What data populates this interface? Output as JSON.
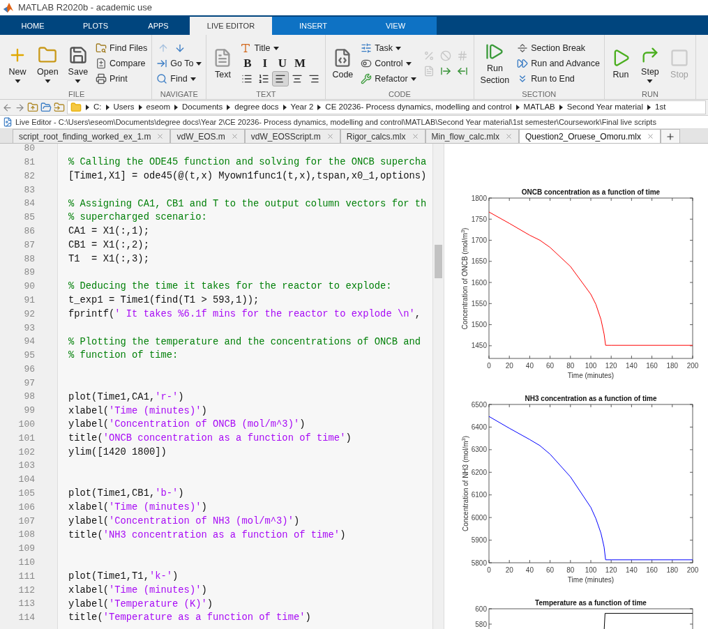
{
  "window": {
    "title": "MATLAB R2020b - academic use"
  },
  "ribbon": {
    "tabs": [
      {
        "label": "HOME",
        "selected": false,
        "kind": "main"
      },
      {
        "label": "PLOTS",
        "selected": false,
        "kind": "main"
      },
      {
        "label": "APPS",
        "selected": false,
        "kind": "main"
      },
      {
        "label": "LIVE EDITOR",
        "selected": true,
        "kind": "main"
      },
      {
        "label": "INSERT",
        "selected": false,
        "kind": "contextual"
      },
      {
        "label": "VIEW",
        "selected": false,
        "kind": "contextual"
      }
    ],
    "groups": [
      {
        "label": "FILE",
        "columns": [
          [
            [
              {
                "kind": "large",
                "label": "New",
                "caret": true
              }
            ]
          ],
          [
            [
              {
                "kind": "large",
                "label": "Open",
                "caret": true
              }
            ]
          ],
          [
            [
              {
                "kind": "large",
                "label": "Save",
                "caret": true
              }
            ]
          ],
          [
            [
              {
                "kind": "small",
                "label": "Find Files"
              }
            ],
            [
              {
                "kind": "small",
                "label": "Compare"
              }
            ],
            [
              {
                "kind": "small",
                "label": "Print"
              }
            ]
          ]
        ]
      },
      {
        "label": "NAVIGATE",
        "columns": [
          [
            [
              {
                "kind": "icon",
                "disabled": true
              },
              {
                "kind": "icon",
                "disabled": false
              }
            ],
            [
              {
                "kind": "small",
                "label": "Go To",
                "caret": true
              }
            ],
            [
              {
                "kind": "small",
                "label": "Find",
                "caret": true
              }
            ]
          ]
        ]
      },
      {
        "label": "TEXT",
        "columns": [
          [
            [
              {
                "kind": "large",
                "label": "Text"
              }
            ]
          ],
          [
            [
              {
                "kind": "small",
                "label": "Title",
                "caret": true
              }
            ],
            [
              {
                "kind": "format",
                "label": "B"
              },
              {
                "kind": "format",
                "label": "I"
              },
              {
                "kind": "format",
                "label": "U"
              },
              {
                "kind": "format",
                "label": "M"
              }
            ],
            [
              {
                "kind": "icon",
                "selected": false
              },
              {
                "kind": "icon",
                "selected": false
              },
              {
                "kind": "icon",
                "selected": true
              },
              {
                "kind": "icon",
                "selected": false
              },
              {
                "kind": "icon",
                "selected": false
              }
            ]
          ]
        ]
      },
      {
        "label": "CODE",
        "columns": [
          [
            [
              {
                "kind": "large",
                "label": "Code"
              }
            ]
          ],
          [
            [
              {
                "kind": "small",
                "label": "Task",
                "caret": true
              }
            ],
            [
              {
                "kind": "small",
                "label": "Control",
                "caret": true
              }
            ],
            [
              {
                "kind": "small",
                "label": "Refactor",
                "caret": true
              }
            ]
          ],
          [
            [
              {
                "kind": "icon",
                "disabled": true
              },
              {
                "kind": "icon",
                "disabled": true
              },
              {
                "kind": "icon",
                "disabled": true
              }
            ],
            [
              {
                "kind": "icon",
                "disabled": true
              },
              {
                "kind": "icon",
                "disabled": false
              },
              {
                "kind": "icon",
                "disabled": false
              }
            ]
          ]
        ]
      },
      {
        "label": "SECTION",
        "columns": [
          [
            [
              {
                "kind": "large",
                "label": "Run Section"
              }
            ]
          ],
          [
            [
              {
                "kind": "small",
                "label": "Section Break"
              }
            ],
            [
              {
                "kind": "small",
                "label": "Run and Advance"
              }
            ],
            [
              {
                "kind": "small",
                "label": "Run to End"
              }
            ]
          ]
        ]
      },
      {
        "label": "RUN",
        "columns": [
          [
            [
              {
                "kind": "large",
                "label": "Run"
              }
            ]
          ],
          [
            [
              {
                "kind": "large",
                "label": "Step",
                "caret": true
              }
            ]
          ],
          [
            [
              {
                "kind": "large",
                "label": "Stop",
                "disabled": true
              }
            ]
          ]
        ]
      }
    ]
  },
  "address_bar": {
    "crumbs": [
      "C:",
      "Users",
      "eseom",
      "Documents",
      "degree docs",
      "Year 2",
      "CE 20236- Process dynamics, modelling and control",
      "MATLAB",
      "Second Year material",
      "1st"
    ]
  },
  "editor_path": "Live Editor - C:\\Users\\eseom\\Documents\\degree docs\\Year 2\\CE 20236- Process dynamics, modelling and control\\MATLAB\\Second Year material\\1st semester\\Coursework\\Final live scripts",
  "file_tabs": [
    {
      "label": "script_root_finding_worked_ex_1.m",
      "selected": false
    },
    {
      "label": "vdW_EOS.m",
      "selected": false
    },
    {
      "label": "vdW_EOSScript.m",
      "selected": false
    },
    {
      "label": "Rigor_calcs.mlx",
      "selected": false
    },
    {
      "label": "Min_flow_calc.mlx",
      "selected": false
    },
    {
      "label": "Question2_Oruese_Omoru.mlx",
      "selected": true
    }
  ],
  "code_lines": [
    {
      "number": "80"
    },
    {
      "number": "81",
      "segments": [
        {
          "kind": "comment",
          "text": "% Calling the ODE45 function and solving for the ONCB supercha"
        }
      ]
    },
    {
      "number": "82",
      "segments": [
        {
          "kind": "code",
          "text": "[Time1,X1] = ode45(@(t,x) Myown1func1(t,x),tspan,x0_1,options)"
        }
      ]
    },
    {
      "number": "83"
    },
    {
      "number": "84",
      "segments": [
        {
          "kind": "comment",
          "text": "% Assigning CA1, CB1 and T to the output column vectors for th"
        }
      ]
    },
    {
      "number": "85",
      "segments": [
        {
          "kind": "comment",
          "text": "% supercharged scenario:"
        }
      ]
    },
    {
      "number": "86",
      "segments": [
        {
          "kind": "code",
          "text": "CA1 = X1(:,1);"
        }
      ]
    },
    {
      "number": "87",
      "segments": [
        {
          "kind": "code",
          "text": "CB1 = X1(:,2);"
        }
      ]
    },
    {
      "number": "88",
      "segments": [
        {
          "kind": "code",
          "text": "T1  = X1(:,3);"
        }
      ]
    },
    {
      "number": "89"
    },
    {
      "number": "90",
      "segments": [
        {
          "kind": "comment",
          "text": "% Deducing the time it takes for the reactor to explode:"
        }
      ]
    },
    {
      "number": "91",
      "segments": [
        {
          "kind": "code",
          "text": "t_exp1 = Time1(find(T1 > 593,1));"
        }
      ]
    },
    {
      "number": "92",
      "segments": [
        {
          "kind": "code",
          "text": "fprintf("
        },
        {
          "kind": "string",
          "text": "' It takes %6.1f mins for the reactor to explode \\n'"
        },
        {
          "kind": "code",
          "text": ","
        }
      ]
    },
    {
      "number": "93"
    },
    {
      "number": "94",
      "segments": [
        {
          "kind": "comment",
          "text": "% Plotting the temperature and the concentrations of ONCB and"
        }
      ]
    },
    {
      "number": "95",
      "segments": [
        {
          "kind": "comment",
          "text": "% function of time:"
        }
      ]
    },
    {
      "number": "96"
    },
    {
      "number": "97"
    },
    {
      "number": "98",
      "segments": [
        {
          "kind": "code",
          "text": "plot(Time1,CA1,"
        },
        {
          "kind": "string",
          "text": "'r-'"
        },
        {
          "kind": "code",
          "text": ")"
        }
      ]
    },
    {
      "number": "99",
      "segments": [
        {
          "kind": "code",
          "text": "xlabel("
        },
        {
          "kind": "string",
          "text": "'Time (minutes)'"
        },
        {
          "kind": "code",
          "text": ")"
        }
      ]
    },
    {
      "number": "100",
      "segments": [
        {
          "kind": "code",
          "text": "ylabel("
        },
        {
          "kind": "string",
          "text": "'Concentration of ONCB (mol/m^3)'"
        },
        {
          "kind": "code",
          "text": ")"
        }
      ]
    },
    {
      "number": "101",
      "segments": [
        {
          "kind": "code",
          "text": "title("
        },
        {
          "kind": "string",
          "text": "'ONCB concentration as a function of time'"
        },
        {
          "kind": "code",
          "text": ")"
        }
      ]
    },
    {
      "number": "102",
      "segments": [
        {
          "kind": "code",
          "text": "ylim([1420 1800])"
        }
      ]
    },
    {
      "number": "103"
    },
    {
      "number": "104"
    },
    {
      "number": "105",
      "segments": [
        {
          "kind": "code",
          "text": "plot(Time1,CB1,"
        },
        {
          "kind": "string",
          "text": "'b-'"
        },
        {
          "kind": "code",
          "text": ")"
        }
      ]
    },
    {
      "number": "106",
      "segments": [
        {
          "kind": "code",
          "text": "xlabel("
        },
        {
          "kind": "string",
          "text": "'Time (minutes)'"
        },
        {
          "kind": "code",
          "text": ")"
        }
      ]
    },
    {
      "number": "107",
      "segments": [
        {
          "kind": "code",
          "text": "ylabel("
        },
        {
          "kind": "string",
          "text": "'Concentration of NH3 (mol/m^3)'"
        },
        {
          "kind": "code",
          "text": ")"
        }
      ]
    },
    {
      "number": "108",
      "segments": [
        {
          "kind": "code",
          "text": "title("
        },
        {
          "kind": "string",
          "text": "'NH3 concentration as a function of time'"
        },
        {
          "kind": "code",
          "text": ")"
        }
      ]
    },
    {
      "number": "109"
    },
    {
      "number": "110"
    },
    {
      "number": "111",
      "segments": [
        {
          "kind": "code",
          "text": "plot(Time1,T1,"
        },
        {
          "kind": "string",
          "text": "'k-'"
        },
        {
          "kind": "code",
          "text": ")"
        }
      ]
    },
    {
      "number": "112",
      "segments": [
        {
          "kind": "code",
          "text": "xlabel("
        },
        {
          "kind": "string",
          "text": "'Time (minutes)'"
        },
        {
          "kind": "code",
          "text": ")"
        }
      ]
    },
    {
      "number": "113",
      "segments": [
        {
          "kind": "code",
          "text": "ylabel("
        },
        {
          "kind": "string",
          "text": "'Temperature (K)'"
        },
        {
          "kind": "code",
          "text": ")"
        }
      ]
    },
    {
      "number": "114",
      "segments": [
        {
          "kind": "code",
          "text": "title("
        },
        {
          "kind": "string",
          "text": "'Temperature as a function of time'"
        },
        {
          "kind": "code",
          "text": ")"
        }
      ]
    }
  ],
  "figures": [
    {
      "chart_data": {
        "type": "line",
        "title": "ONCB concentration as a function of time",
        "xlabel": "Time (minutes)",
        "ylabel": "Concentration of ONCB (mol/m$^{3}$)",
        "xlim": [
          0,
          200
        ],
        "ylim": [
          1420,
          1800
        ],
        "xticks": [
          0,
          20,
          40,
          60,
          80,
          100,
          120,
          140,
          160,
          180,
          200
        ],
        "yticks": [
          1450,
          1500,
          1550,
          1600,
          1650,
          1700,
          1750,
          1800
        ],
        "x": [
          0,
          20,
          40,
          50,
          60,
          80,
          100,
          105,
          110,
          113,
          114.5,
          120,
          200
        ],
        "series": [
          {
            "color": "#ff0000",
            "values": [
              1767,
              1740,
              1712,
              1700,
              1683,
              1638,
              1572,
              1548,
              1512,
              1478,
              1451,
              1451,
              1451
            ]
          }
        ]
      }
    },
    {
      "chart_data": {
        "type": "line",
        "title": "NH3 concentration as a function of time",
        "xlabel": "Time (minutes)",
        "ylabel": "Concentration of NH3 (mol/m$^{3}$)",
        "xlim": [
          0,
          200
        ],
        "ylim": [
          5800,
          6500
        ],
        "xticks": [
          0,
          20,
          40,
          60,
          80,
          100,
          120,
          140,
          160,
          180,
          200
        ],
        "yticks": [
          5800,
          5900,
          6000,
          6100,
          6200,
          6300,
          6400,
          6500
        ],
        "x": [
          0,
          20,
          40,
          50,
          60,
          80,
          100,
          105,
          110,
          113,
          114.5,
          120,
          200
        ],
        "series": [
          {
            "color": "#0000ff",
            "values": [
              6447,
              6395,
              6345,
              6318,
              6280,
              6180,
              6045,
              5995,
              5930,
              5870,
              5813,
              5813,
              5813
            ]
          }
        ]
      }
    },
    {
      "chart_data": {
        "type": "line",
        "title": "Temperature as a function of time",
        "xlim": [
          0,
          200
        ],
        "ylim": [
          570,
          600
        ],
        "yticks": [
          580,
          600
        ],
        "x": [
          113,
          114,
          200
        ],
        "series": [
          {
            "color": "#000000",
            "values": [
              570,
              594,
              594
            ]
          }
        ]
      }
    }
  ]
}
